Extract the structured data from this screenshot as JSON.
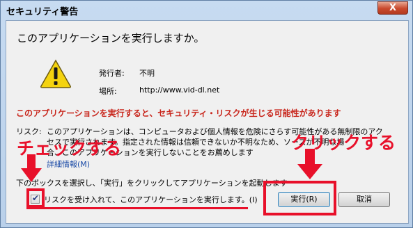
{
  "window": {
    "title": "セキュリティ警告",
    "close_label": "X"
  },
  "dialog": {
    "question": "このアプリケーションを実行しますか。",
    "publisher_label": "発行者:",
    "publisher_value": "不明",
    "location_label": "場所:",
    "location_value": "http://www.vid-dl.net",
    "red_warning": "このアプリケーションを実行すると、セキュリティ・リスクが生じる可能性があります",
    "risk_label": "リスク:",
    "risk_lines": [
      "このアプリケーションは、コンピュータおよび個人情報を危険にさらす可能性がある無制限のアク",
      "セスで実行されます。指定された情報は信頼できないか不明なため、ソースが不明な場",
      "合、このアプリケーションを実行しないことをお薦めします"
    ],
    "details_link": "詳細情報(M)",
    "instruction": "下のボックスを選択し、「実行」をクリックしてアプリケーションを起動します",
    "checkbox_label": "リスクを受け入れて、このアプリケーションを実行します。(I)",
    "checkbox_checked": true,
    "run_button": "実行(R)",
    "cancel_button": "取消"
  },
  "annotations": {
    "check_text": "チェックする",
    "click_text": "クリックする",
    "color": "#e8102a"
  }
}
